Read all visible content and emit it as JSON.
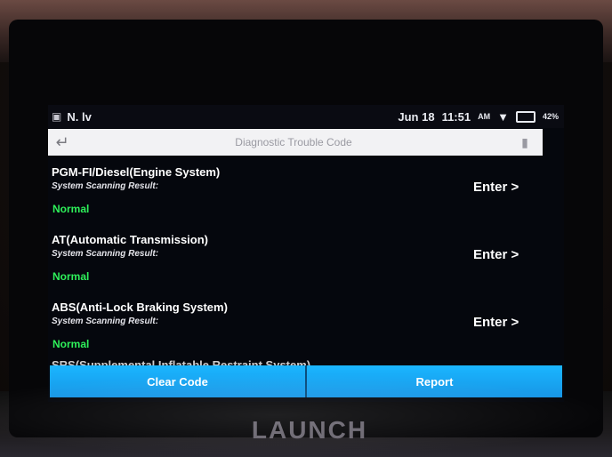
{
  "status_bar": {
    "left_indicators": "N. lv",
    "date": "Jun 18",
    "time": "11:51",
    "meridiem": "AM",
    "battery": "42%"
  },
  "header": {
    "title": "Diagnostic Trouble Code"
  },
  "systems": [
    {
      "name": "PGM-FI/Diesel(Engine System)",
      "subtitle": "System Scanning Result:",
      "status": "Normal",
      "action": "Enter >"
    },
    {
      "name": "AT(Automatic Transmission)",
      "subtitle": "System Scanning Result:",
      "status": "Normal",
      "action": "Enter >"
    },
    {
      "name": "ABS(Anti-Lock Braking System)",
      "subtitle": "System Scanning Result:",
      "status": "Normal",
      "action": "Enter >"
    }
  ],
  "partial_item": "SRS(Supplemental Inflatable Restraint System)",
  "actions": {
    "clear_code": "Clear Code",
    "report": "Report"
  },
  "device_brand": "LAUNCH",
  "colors": {
    "accent": "#1ab6ff",
    "status_ok": "#2ef05a"
  }
}
